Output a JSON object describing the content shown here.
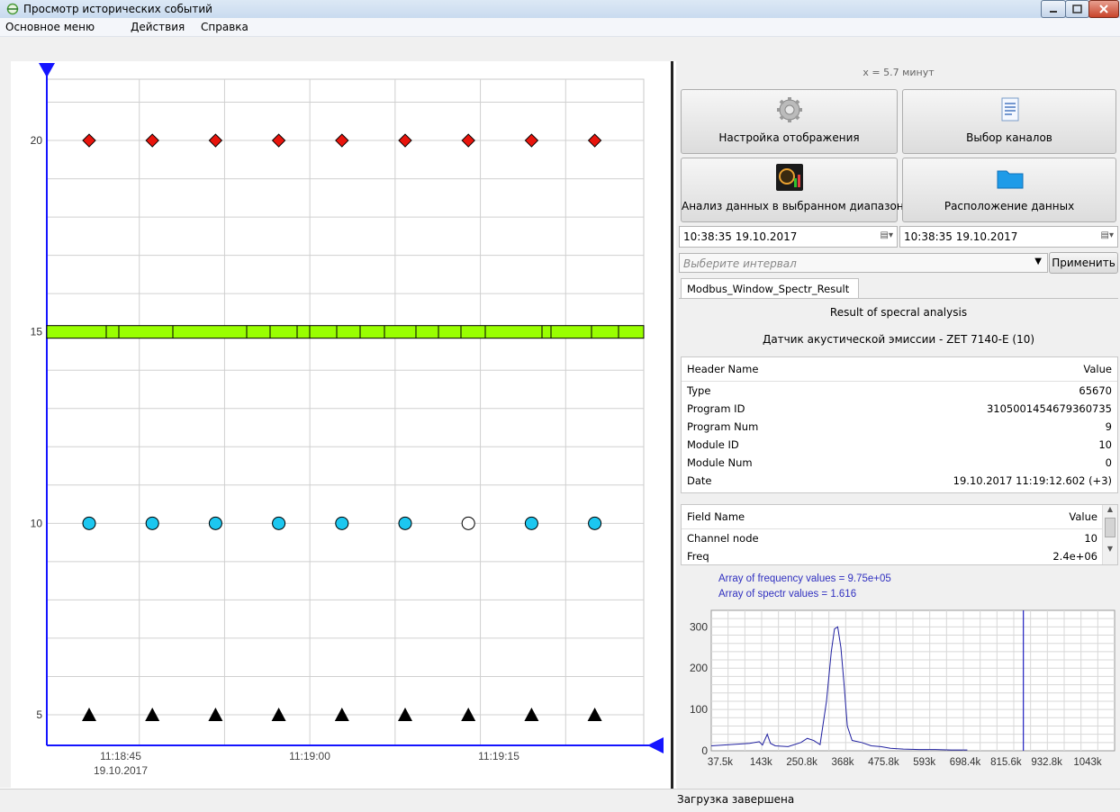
{
  "window": {
    "title": "Просмотр исторических событий"
  },
  "menu": [
    "Основное меню",
    "Действия",
    "Справка"
  ],
  "colors": {
    "red_marker": "#e8140c",
    "green_bar": "#99ff00",
    "cyan_marker": "#1cc7f0",
    "axis": "#1414ff"
  },
  "chart_data": [
    {
      "type": "scatter",
      "title": "",
      "x_ticks": [
        {
          "time": "11:18:45",
          "date": "19.10.2017"
        },
        {
          "time": "11:19:00",
          "date": ""
        },
        {
          "time": "11:19:15",
          "date": ""
        }
      ],
      "y_ticks": [
        "20",
        "15",
        "10",
        "5"
      ],
      "ylim": [
        4.2,
        21.6
      ],
      "grid": true,
      "series": [
        {
          "shape": "diamond",
          "color": "#e8140c",
          "y": 20,
          "points": 9
        },
        {
          "shape": "circle",
          "color": "#1cc7f0",
          "y": 10,
          "points": 9,
          "hollow_index": 6
        },
        {
          "shape": "triangle",
          "color": "#000000",
          "y": 5,
          "points": 9
        },
        {
          "shape": "bar",
          "color": "#99ff00",
          "y": 15,
          "segments": 20
        }
      ]
    },
    {
      "type": "line",
      "annotations": [
        "Array of frequency values = 9.75e+05",
        "Array of spectr values = 1.616"
      ],
      "x_tick_labels": [
        "37.5k",
        "143k",
        "250.8k",
        "368k",
        "475.8k",
        "593k",
        "698.4k",
        "815.6k",
        "932.8k",
        "1043k"
      ],
      "y_ticks": [
        0,
        100,
        200,
        300
      ],
      "ylim": [
        0,
        340
      ],
      "xlim": [
        0,
        1260
      ],
      "cursor_x": 975,
      "grid": true,
      "x": [
        0,
        60,
        120,
        150,
        160,
        175,
        185,
        200,
        240,
        280,
        300,
        320,
        340,
        360,
        375,
        385,
        395,
        405,
        415,
        425,
        440,
        470,
        500,
        530,
        560,
        600,
        650,
        700,
        750,
        800
      ],
      "y": [
        12,
        15,
        18,
        22,
        14,
        40,
        18,
        12,
        10,
        20,
        30,
        25,
        15,
        120,
        240,
        295,
        300,
        250,
        160,
        60,
        25,
        20,
        12,
        10,
        6,
        4,
        3,
        3,
        2,
        2
      ]
    }
  ],
  "right_panel": {
    "x_readout": "x = 5.7 минут",
    "buttons": {
      "display_settings": "Настройка отображения",
      "channel_select": "Выбор каналов",
      "analysis": "Анализ данных в выбранном диапазоне",
      "data_location": "Расположение данных"
    },
    "date_from": "10:38:35 19.10.2017",
    "date_to": "10:38:35 19.10.2017",
    "interval_placeholder": "Выберите интервал",
    "apply": "Применить",
    "tab": "Modbus_Window_Spectr_Result",
    "result_title": "Result of specral analysis",
    "sensor": "Датчик акустической эмиссии - ZET 7140-E (10)",
    "header_table": {
      "columns": [
        "Header Name",
        "Value"
      ],
      "rows": [
        [
          "Type",
          "65670"
        ],
        [
          "Program ID",
          "3105001454679360735"
        ],
        [
          "Program Num",
          "9"
        ],
        [
          "Module ID",
          "10"
        ],
        [
          "Module Num",
          "0"
        ],
        [
          "Date",
          "19.10.2017 11:19:12.602 (+3)"
        ]
      ]
    },
    "field_table": {
      "columns": [
        "Field Name",
        "Value"
      ],
      "rows": [
        [
          "Channel node",
          "10"
        ],
        [
          "Freq",
          "2.4e+06"
        ]
      ]
    }
  },
  "status": "Загрузка завершена"
}
